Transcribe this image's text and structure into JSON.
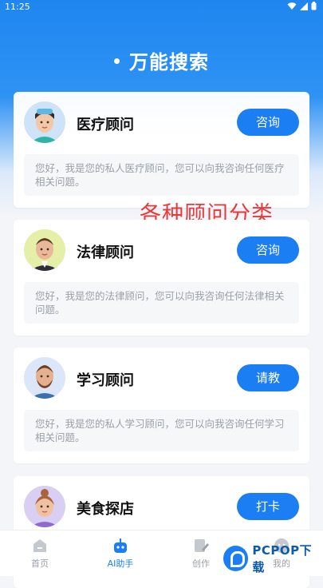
{
  "status": {
    "time": "11:25"
  },
  "header": {
    "title": "万能搜索"
  },
  "cards": [
    {
      "name": "医疗顾问",
      "action": "咨询",
      "desc": "您好，我是您的私人医疗顾问，您可以向我咨询任何医疗相关问题。"
    },
    {
      "name": "法律顾问",
      "action": "咨询",
      "desc": "您好，我是您的法律顾问，您可以向我咨询任何法律相关问题。"
    },
    {
      "name": "学习顾问",
      "action": "请教",
      "desc": "您好，我是您的私人学习顾问，您可以向我咨询任何学习相关问题。"
    },
    {
      "name": "美食探店",
      "action": "打卡",
      "desc": ""
    }
  ],
  "annotation": "各种顾问分类",
  "tabs": [
    {
      "label": "首页",
      "icon": "home-icon"
    },
    {
      "label": "AI助手",
      "icon": "robot-icon",
      "active": true
    },
    {
      "label": "创作",
      "icon": "edit-icon"
    },
    {
      "label": "我的",
      "icon": "user-icon"
    }
  ],
  "watermark": {
    "text": "PCPOP下载"
  },
  "colors": {
    "primary": "#1b7ff3",
    "annotation": "#e8393a"
  }
}
